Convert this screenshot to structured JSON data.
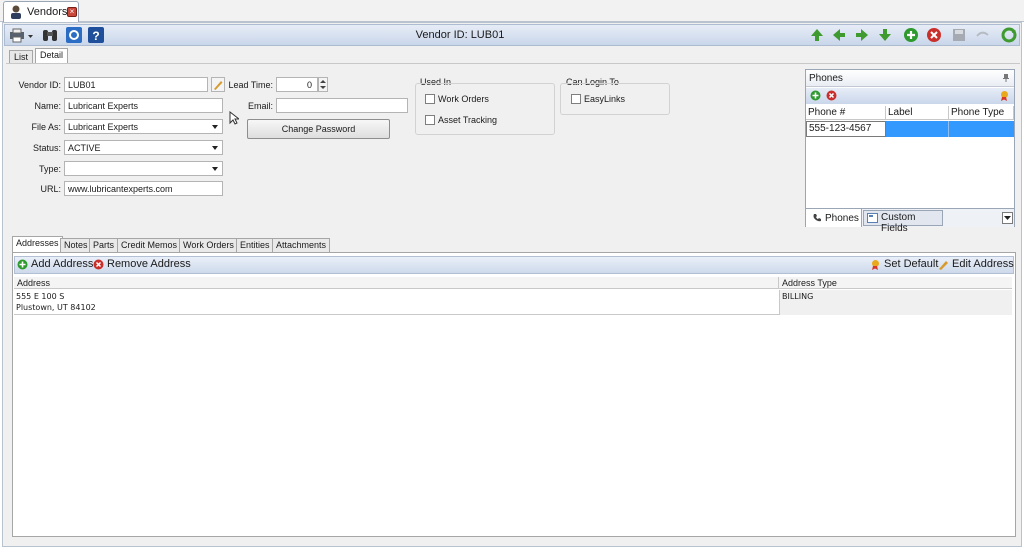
{
  "window": {
    "tab_title": "Vendors"
  },
  "toolbar": {
    "title": "Vendor ID: LUB01"
  },
  "subtabs": [
    {
      "label": "List"
    },
    {
      "label": "Detail"
    }
  ],
  "form": {
    "vendor_id_label": "Vendor ID:",
    "vendor_id": "LUB01",
    "name_label": "Name:",
    "name": "Lubricant Experts",
    "file_as_label": "File As:",
    "file_as": "Lubricant Experts",
    "status_label": "Status:",
    "status": "ACTIVE",
    "type_label": "Type:",
    "type": "",
    "url_label": "URL:",
    "url": "www.lubricantexperts.com",
    "lead_time_label": "Lead Time:",
    "lead_time": "0",
    "email_label": "Email:",
    "email": "",
    "change_password": "Change Password"
  },
  "used_in": {
    "title": "Used In",
    "work_orders": "Work Orders",
    "asset_tracking": "Asset Tracking"
  },
  "can_login": {
    "title": "Can Login To",
    "easylinks": "EasyLinks"
  },
  "phones": {
    "title": "Phones",
    "columns": [
      "Phone #",
      "Label",
      "Phone Type"
    ],
    "rows": [
      {
        "phone": "555-123-4567",
        "label": "",
        "type": ""
      }
    ],
    "tab_phones": "Phones",
    "tab_custom": "Custom Fields"
  },
  "lower_tabs": [
    "Addresses",
    "Notes",
    "Parts",
    "Credit Memos",
    "Work Orders",
    "Entities",
    "Attachments"
  ],
  "addresses": {
    "add": "Add Address",
    "remove": "Remove Address",
    "set_default": "Set Default",
    "edit": "Edit Address",
    "columns": [
      "Address",
      "Address Type"
    ],
    "rows": [
      {
        "line1": "555 E 100 S",
        "line2": "Plustown, UT  84102",
        "type": "BILLING"
      }
    ]
  },
  "colors": {
    "accent": "#1f7de0",
    "selected_row": "#3399ff",
    "green": "#2e9a2e",
    "red": "#c9302c"
  }
}
